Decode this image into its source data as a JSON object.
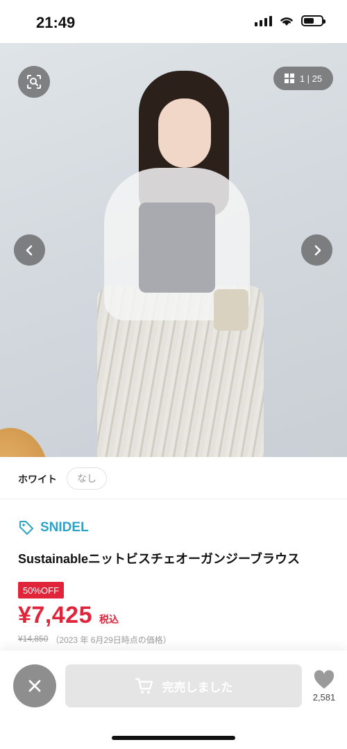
{
  "status_bar": {
    "time": "21:49"
  },
  "gallery": {
    "counter": "1 | 25"
  },
  "variant": {
    "color": "ホワイト",
    "size": "なし"
  },
  "product": {
    "brand": "SNIDEL",
    "title": "Sustainableニットビスチェオーガンジーブラウス",
    "discount": "50%OFF",
    "price": "¥7,425",
    "tax_label": "税込",
    "original_price": "¥14,850",
    "price_note": "（2023 年 6月29日時点の価格）"
  },
  "actions": {
    "soldout_label": "完売しました",
    "favorite_count": "2,581"
  },
  "colors": {
    "accent_red": "#e0243a",
    "brand_blue": "#2aa3c6",
    "disabled_button": "#e5e5e5"
  },
  "icons": [
    "zoom-search-icon",
    "grid-icon",
    "chevron-left-icon",
    "chevron-right-icon",
    "tag-icon",
    "close-icon",
    "cart-icon",
    "heart-icon"
  ]
}
